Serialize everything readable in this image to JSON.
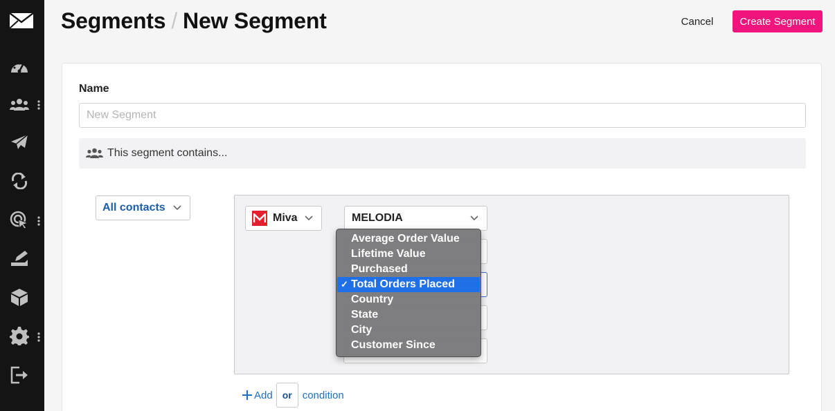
{
  "header": {
    "breadcrumb_parent": "Segments",
    "breadcrumb_separator": "/",
    "page_title": "New Segment",
    "cancel_label": "Cancel",
    "create_label": "Create Segment"
  },
  "form": {
    "name_label": "Name",
    "name_value": "",
    "name_placeholder": "New Segment",
    "contains_text": "This segment contains..."
  },
  "conditions": {
    "match_select": "All contacts",
    "source_select": "Miva",
    "store_select": "MELODIA",
    "add_label": "Add",
    "or_label": "or",
    "condition_label": "condition"
  },
  "dropdown": {
    "check_mark": "✓",
    "options": [
      {
        "label": "Average Order Value"
      },
      {
        "label": "Lifetime Value"
      },
      {
        "label": "Purchased"
      },
      {
        "label": "Total Orders Placed"
      },
      {
        "label": "Country"
      },
      {
        "label": "State"
      },
      {
        "label": "City"
      },
      {
        "label": "Customer Since"
      }
    ],
    "selected_index": 3
  },
  "colors": {
    "sidebar_bg": "#141414",
    "primary_pink": "#f0147c",
    "link_blue": "#1c6fc2",
    "selected_option": "#1f6fe6",
    "miva_red": "#e4202e"
  },
  "icons": {
    "sidebar": [
      "mail-logo-icon",
      "dashboard-icon",
      "contacts-icon",
      "campaigns-icon",
      "automations-icon",
      "tracking-icon",
      "forms-icon",
      "integrations-icon",
      "settings-icon",
      "logout-icon"
    ]
  }
}
